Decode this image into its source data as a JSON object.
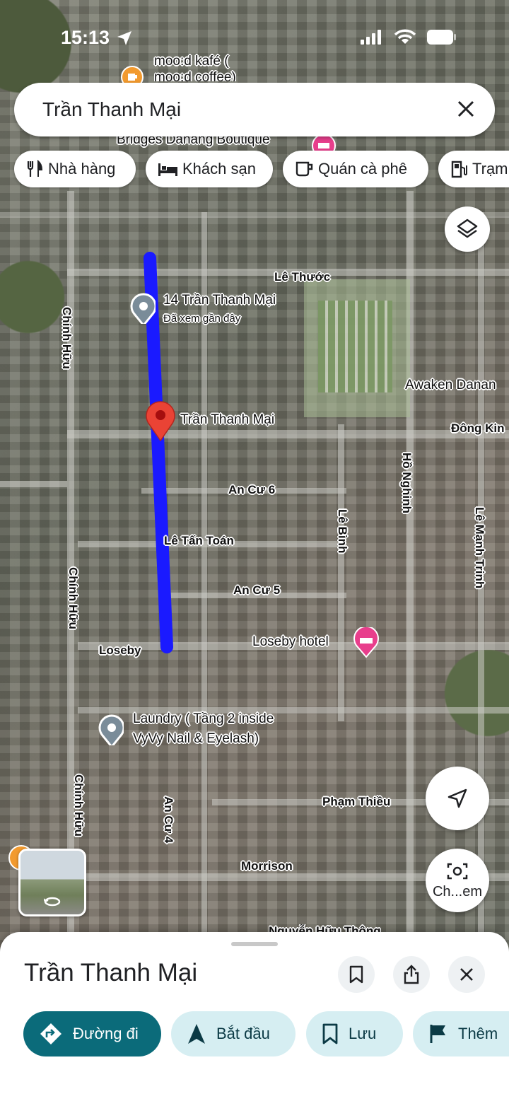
{
  "status_bar": {
    "time": "15:13"
  },
  "search": {
    "query": "Trần Thanh Mại"
  },
  "chips": [
    {
      "label": "Nhà hàng",
      "icon": "fork-knife-icon"
    },
    {
      "label": "Khách sạn",
      "icon": "bed-icon"
    },
    {
      "label": "Quán cà phê",
      "icon": "coffee-cup-icon"
    },
    {
      "label": "Trạm",
      "icon": "gas-station-icon"
    }
  ],
  "map": {
    "poi_labels": {
      "mood_cafe": "moo:d kafé (",
      "mood_cafe_2": "moo:d coffee)",
      "bridges": "Bridges Danang Boutique",
      "awaken": "Awaken Danan",
      "loseby_hotel": "Loseby hotel",
      "laundry_1": "Laundry ( Tầng 2 inside",
      "laundry_2": "VyVy Nail & Eyelash)",
      "place_14": "14 Trần Thanh Mại",
      "place_14_sub": "Đã xem gần đây",
      "selected_pin": "Trần Thanh Mại"
    },
    "street_labels": {
      "le_thuoc": "Lê Thước",
      "dong_kinh": "Đông Kin",
      "an_cu_6": "An Cư 6",
      "le_tan_toan": "Lê Tấn Toán",
      "an_cu_5": "An Cư 5",
      "loseby": "Loseby",
      "pham_thieu": "Phạm Thiều",
      "morrison": "Morrison",
      "huu_thong": "Nguyễn Hữu Thông",
      "chinh_huu_1": "Chính Hữu",
      "chinh_huu_2": "Chính Hữu",
      "chinh_huu_3": "Chính Hữu",
      "ho_nghinh": "Hồ Nghinh",
      "le_binh": "Lê Bình",
      "le_manh_trinh": "Lê Mạnh Trinh",
      "an_cu_4": "An Cư 4"
    },
    "route_color": "#1a1aff",
    "pin_color": "#ea4335",
    "camera_button_label": "Ch...em"
  },
  "sheet": {
    "title": "Trần Thanh Mại",
    "actions": [
      {
        "label": "Đường đi",
        "icon": "directions-icon"
      },
      {
        "label": "Bắt đầu",
        "icon": "navigation-arrow-icon"
      },
      {
        "label": "Lưu",
        "icon": "bookmark-icon"
      },
      {
        "label": "Thêm",
        "icon": "flag-icon"
      }
    ],
    "primary_color": "#0b6b7a",
    "secondary_color": "#d6eef2"
  }
}
